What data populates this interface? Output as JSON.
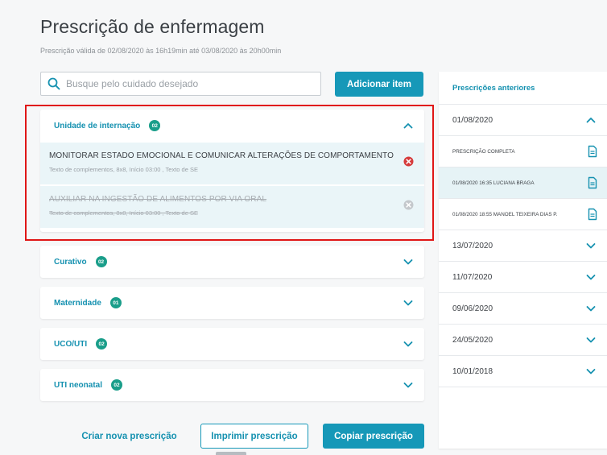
{
  "header": {
    "title": "Prescrição de enfermagem",
    "subtitle": "Prescrição válida de 02/08/2020 às 16h19min até 03/08/2020 às 20h00min"
  },
  "search": {
    "placeholder": "Busque pelo cuidado desejado",
    "value": ""
  },
  "toolbar": {
    "add_label": "Adicionar item"
  },
  "sections": [
    {
      "label": "Unidade de internação",
      "count": "02",
      "expanded": true,
      "items": [
        {
          "title": "MONITORAR ESTADO EMOCIONAL E COMUNICAR ALTERAÇÕES DE COMPORTAMENTO",
          "desc": "Texto de complementos, 8x8, Início 03:00 , Texto de SE",
          "struck": false
        },
        {
          "title": "AUXILIAR NA INGESTÃO DE ALIMENTOS POR VIA ORAL",
          "desc": "Texto de complementos, 8x8, Início 03:00 , Texto de SE",
          "struck": true
        }
      ]
    },
    {
      "label": "Curativo",
      "count": "02",
      "expanded": false
    },
    {
      "label": "Maternidade",
      "count": "01",
      "expanded": false
    },
    {
      "label": "UCO/UTI",
      "count": "02",
      "expanded": false
    },
    {
      "label": "UTI neonatal",
      "count": "02",
      "expanded": false
    }
  ],
  "footer": {
    "new_label": "Criar nova prescrição",
    "print_label": "Imprimir prescrição",
    "copy_label": "Copiar prescrição"
  },
  "history": {
    "title": "Prescrições anteriores",
    "dates": [
      {
        "date": "01/08/2020",
        "expanded": true,
        "entries": [
          {
            "label": "PRESCRIÇÃO COMPLETA",
            "selected": false
          },
          {
            "label": "01/08/2020 16:35 LUCIANA BRAGA",
            "selected": true
          },
          {
            "label": "01/08/2020 18:55 MANOEL TEIXEIRA DIAS P.",
            "selected": false
          }
        ]
      },
      {
        "date": "13/07/2020",
        "expanded": false
      },
      {
        "date": "11/07/2020",
        "expanded": false
      },
      {
        "date": "09/06/2020",
        "expanded": false
      },
      {
        "date": "24/05/2020",
        "expanded": false
      },
      {
        "date": "10/01/2018",
        "expanded": false
      }
    ]
  },
  "colors": {
    "accent": "#1698b8",
    "badge": "#1a9e8a",
    "remove_active": "#d63c3c",
    "remove_inactive": "#c4c8cc",
    "highlight_border": "#e01616"
  },
  "icons": {
    "search": "search-icon",
    "chevron_up": "chevron-up-icon",
    "chevron_down": "chevron-down-icon",
    "remove": "remove-circle-icon",
    "document": "document-icon"
  }
}
